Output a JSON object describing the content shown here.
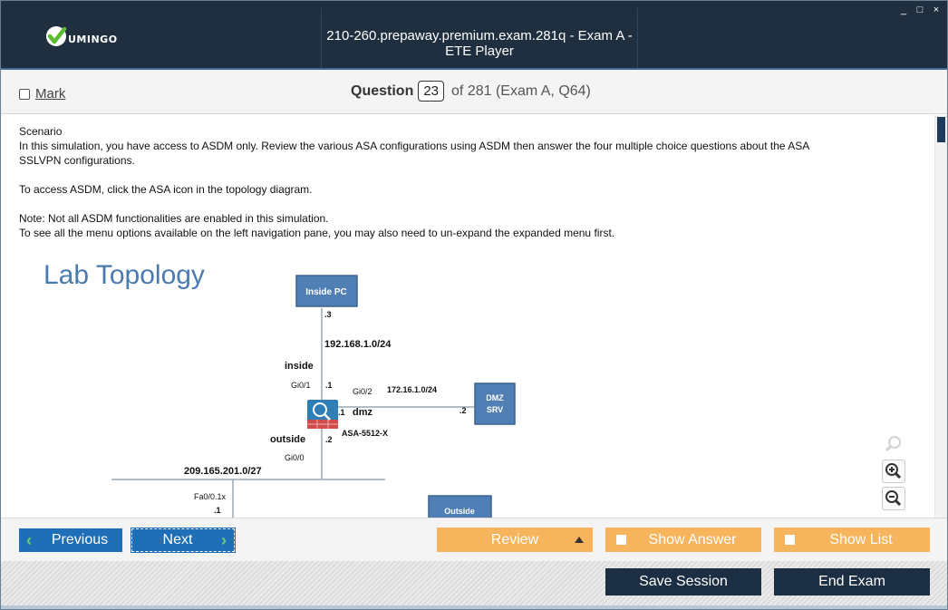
{
  "app": {
    "logo_text": "UMINGO",
    "title": "210-260.prepaway.premium.exam.281q - Exam A - ETE Player",
    "window_controls": {
      "minimize": "_",
      "maximize": "□",
      "close": "×"
    }
  },
  "question_bar": {
    "mark_label": "Mark",
    "question_label": "Question",
    "question_number": "23",
    "of_text": "of 281 (Exam A, Q64)"
  },
  "content": {
    "heading": "Scenario",
    "line1": "In this simulation, you have access to ASDM only. Review the various ASA configurations using ASDM then answer the four multiple choice questions about the ASA",
    "line2": "SSLVPN configurations.",
    "line3": "To access ASDM, click the ASA icon in the topology diagram.",
    "line4": "Note: Not all ASDM functionalities are enabled in this simulation.",
    "line5": "To see all the menu options available on the left navigation pane, you may also need to un-expand the expanded menu first."
  },
  "topology": {
    "title": "Lab Topology",
    "inside_pc": "Inside PC",
    "inside_pc_host": ".3",
    "inside_net": "192.168.1.0/24",
    "inside_label": "inside",
    "gi01": "Gi0/1",
    "gi01_host": ".1",
    "gi02": "Gi0/2",
    "dmz_net": "172.16.1.0/24",
    "dmz_srv_line1": "DMZ",
    "dmz_srv_line2": "SRV",
    "dmz_srv_host": ".2",
    "dmz_host": ".1",
    "dmz_label": "dmz",
    "asa_label": "ASA-5512-X",
    "outside_label": "outside",
    "outside_host": ".2",
    "gi00": "Gi0/0",
    "outside_net": "209.165.201.0/27",
    "fa01": "Fa0/0.1x",
    "fa01_host": ".1",
    "outside_box": "Outside"
  },
  "nav": {
    "previous": "Previous",
    "next": "Next",
    "review": "Review",
    "show_answer": "Show Answer",
    "show_list": "Show List",
    "save_session": "Save Session",
    "end_exam": "End Exam"
  },
  "colors": {
    "header_bg": "#1f2f40",
    "nav_blue": "#1e6fb8",
    "orange": "#f6b45c",
    "dark_button": "#1c2e42",
    "device_blue": "#4f7fb5",
    "title_blue": "#4a7ab0"
  }
}
